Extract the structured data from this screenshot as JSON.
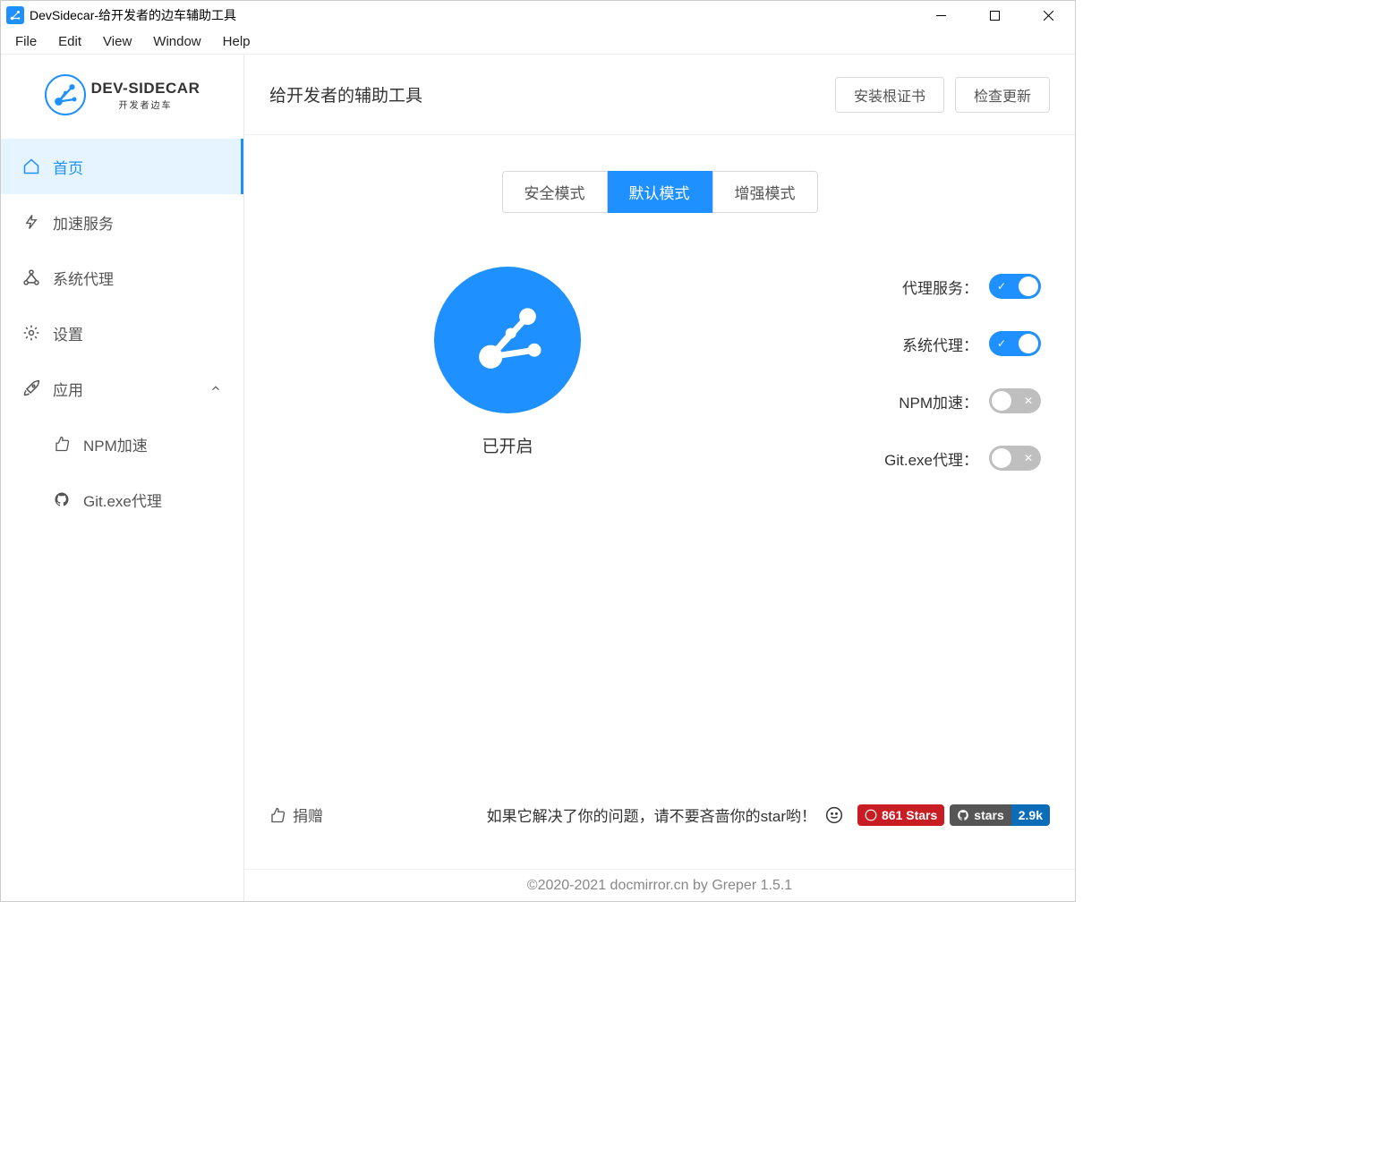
{
  "window": {
    "title": "DevSidecar-给开发者的边车辅助工具"
  },
  "menubar": [
    "File",
    "Edit",
    "View",
    "Window",
    "Help"
  ],
  "logo": {
    "main": "DEV-SIDECAR",
    "sub": "开发者边车"
  },
  "sidebar": {
    "items": [
      {
        "label": "首页"
      },
      {
        "label": "加速服务"
      },
      {
        "label": "系统代理"
      },
      {
        "label": "设置"
      },
      {
        "label": "应用"
      }
    ],
    "sub": [
      {
        "label": "NPM加速"
      },
      {
        "label": "Git.exe代理"
      }
    ]
  },
  "header": {
    "title": "给开发者的辅助工具",
    "install_cert": "安装根证书",
    "check_update": "检查更新"
  },
  "tabs": [
    "安全模式",
    "默认模式",
    "增强模式"
  ],
  "status": {
    "label": "已开启"
  },
  "toggles": [
    {
      "label": "代理服务：",
      "on": true
    },
    {
      "label": "系统代理：",
      "on": true
    },
    {
      "label": "NPM加速：",
      "on": false
    },
    {
      "label": "Git.exe代理：",
      "on": false
    }
  ],
  "footer": {
    "donate": "捐赠",
    "star_text": "如果它解决了你的问题，请不要吝啬你的star哟！",
    "gitee_stars": "861 Stars",
    "gh_label": "stars",
    "gh_count": "2.9k"
  },
  "copyright": "©2020-2021 docmirror.cn by Greper 1.5.1"
}
